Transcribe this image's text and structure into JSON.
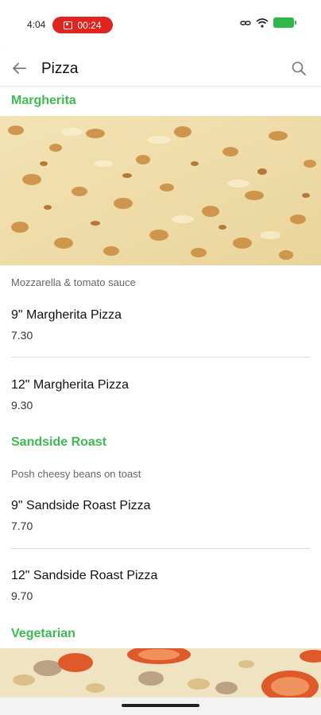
{
  "status_bar": {
    "time": "4:04",
    "recording": "00:24"
  },
  "header": {
    "title": "Pizza"
  },
  "sections": [
    {
      "title": "Margherita",
      "description": "Mozzarella & tomato sauce",
      "items": [
        {
          "name": "9\" Margherita Pizza",
          "price": "7.30"
        },
        {
          "name": "12\" Margherita Pizza",
          "price": "9.30"
        }
      ]
    },
    {
      "title": "Sandside Roast",
      "description": "Posh cheesy beans on toast",
      "items": [
        {
          "name": "9\" Sandside Roast Pizza",
          "price": "7.70"
        },
        {
          "name": "12\" Sandside Roast Pizza",
          "price": "9.70"
        }
      ]
    },
    {
      "title": "Vegetarian"
    }
  ],
  "colors": {
    "accent": "#3dbb52",
    "recording": "#e0241f",
    "battery": "#2fb84a"
  }
}
